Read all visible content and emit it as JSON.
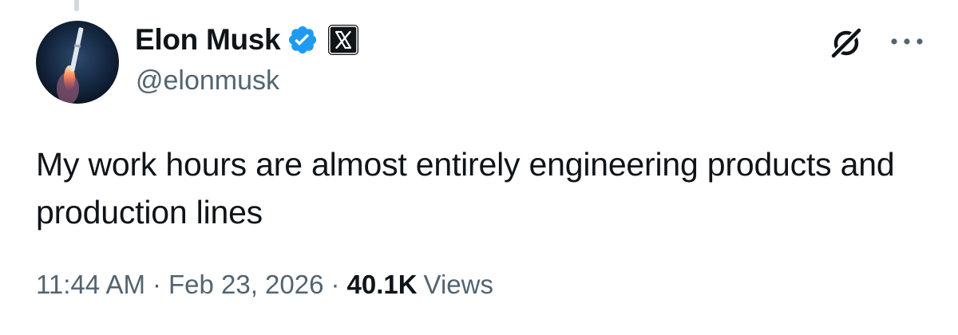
{
  "author": {
    "display_name": "Elon Musk",
    "handle": "@elonmusk",
    "verified": true,
    "verified_color": "#1d9bf0",
    "affiliate_badge": "x-logo-icon"
  },
  "actions": {
    "grok_icon": "grok-icon",
    "more_icon": "more-dots-icon"
  },
  "tweet": {
    "text": "My work hours are almost entirely engineering products and production lines"
  },
  "meta": {
    "time": "11:44 AM",
    "separator": "·",
    "date": "Feb 23, 2026",
    "views_count": "40.1K",
    "views_label": "Views"
  },
  "colors": {
    "text_primary": "#0f1419",
    "text_secondary": "#536471",
    "verified_blue": "#1d9bf0"
  }
}
